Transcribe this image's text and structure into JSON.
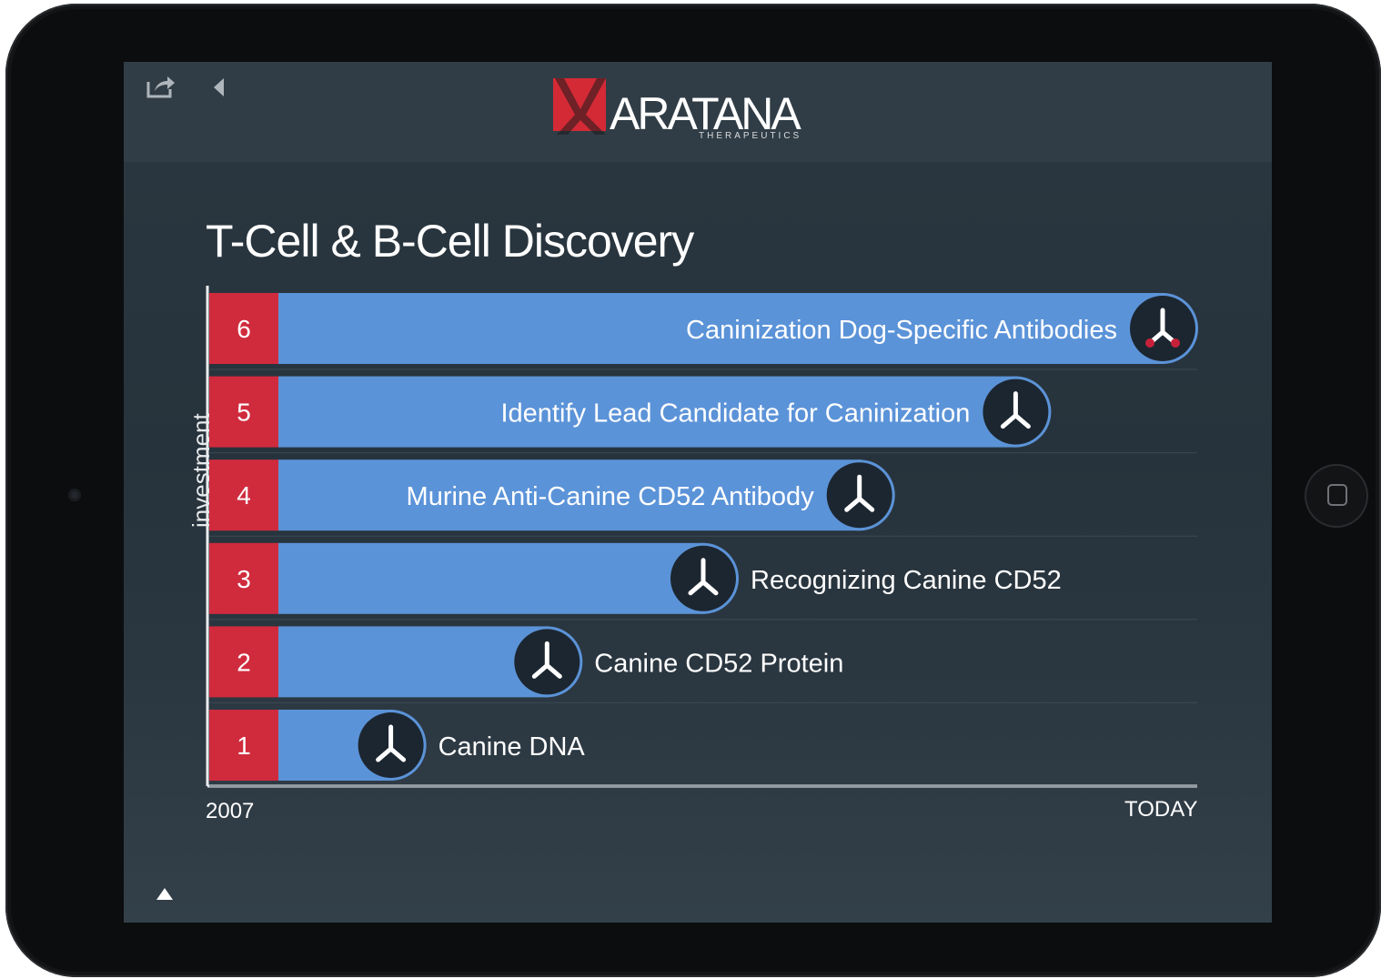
{
  "header": {
    "logo_text": "ARATANA",
    "logo_subtext": "THERAPEUTICS",
    "share_icon": "share-icon",
    "back_icon": "back-arrow-icon"
  },
  "page": {
    "title": "T-Cell & B-Cell Discovery"
  },
  "footer": {
    "up_icon": "up-triangle-icon"
  },
  "colors": {
    "bar": "#5b93d8",
    "step": "#d02b3d",
    "icon_bg": "#1c2630",
    "accent": "#c6213a"
  },
  "chart_data": {
    "type": "bar",
    "ylabel": "investment",
    "xlabel_left": "2007",
    "xlabel_right": "TODAY",
    "xlim": [
      0,
      1
    ],
    "steps": [
      {
        "step": "1",
        "label": "Canine DNA",
        "value": 0.16,
        "icon": "dna-icon"
      },
      {
        "step": "2",
        "label": "Canine CD52 Protein",
        "value": 0.33,
        "icon": "protein-icon"
      },
      {
        "step": "3",
        "label": "Recognizing Canine CD52",
        "value": 0.5,
        "icon": "mouse-icon"
      },
      {
        "step": "4",
        "label": "Murine Anti-Canine CD52 Antibody",
        "value": 0.67,
        "icon": "antibody-icon"
      },
      {
        "step": "5",
        "label": "Identify Lead Candidate for Caninization",
        "value": 0.84,
        "icon": "antibody-cluster-icon"
      },
      {
        "step": "6",
        "label": "Caninization Dog-Specific Antibodies",
        "value": 1.0,
        "icon": "dog-antibody-icon"
      }
    ]
  }
}
